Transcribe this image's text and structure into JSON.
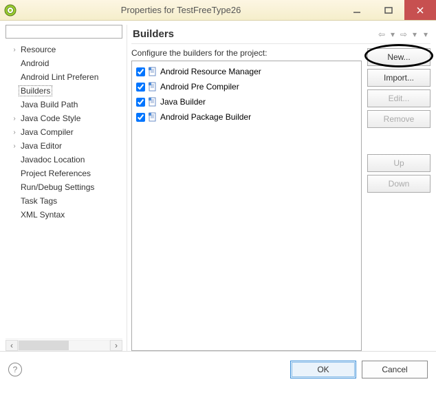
{
  "window": {
    "title": "Properties for TestFreeType26"
  },
  "nav": {
    "items": [
      {
        "label": "Resource",
        "expandable": true
      },
      {
        "label": "Android",
        "expandable": false
      },
      {
        "label": "Android Lint Preferen",
        "expandable": false
      },
      {
        "label": "Builders",
        "expandable": false,
        "selected": true
      },
      {
        "label": "Java Build Path",
        "expandable": false
      },
      {
        "label": "Java Code Style",
        "expandable": true
      },
      {
        "label": "Java Compiler",
        "expandable": true
      },
      {
        "label": "Java Editor",
        "expandable": true
      },
      {
        "label": "Javadoc Location",
        "expandable": false
      },
      {
        "label": "Project References",
        "expandable": false
      },
      {
        "label": "Run/Debug Settings",
        "expandable": false
      },
      {
        "label": "Task Tags",
        "expandable": false
      },
      {
        "label": "XML Syntax",
        "expandable": false
      }
    ]
  },
  "page": {
    "title": "Builders",
    "instruction": "Configure the builders for the project:",
    "builders": [
      {
        "label": "Android Resource Manager",
        "checked": true
      },
      {
        "label": "Android Pre Compiler",
        "checked": true
      },
      {
        "label": "Java Builder",
        "checked": true
      },
      {
        "label": "Android Package Builder",
        "checked": true
      }
    ],
    "buttons": {
      "new": "New...",
      "import": "Import...",
      "edit": "Edit...",
      "remove": "Remove",
      "up": "Up",
      "down": "Down"
    }
  },
  "dialog": {
    "ok": "OK",
    "cancel": "Cancel"
  }
}
